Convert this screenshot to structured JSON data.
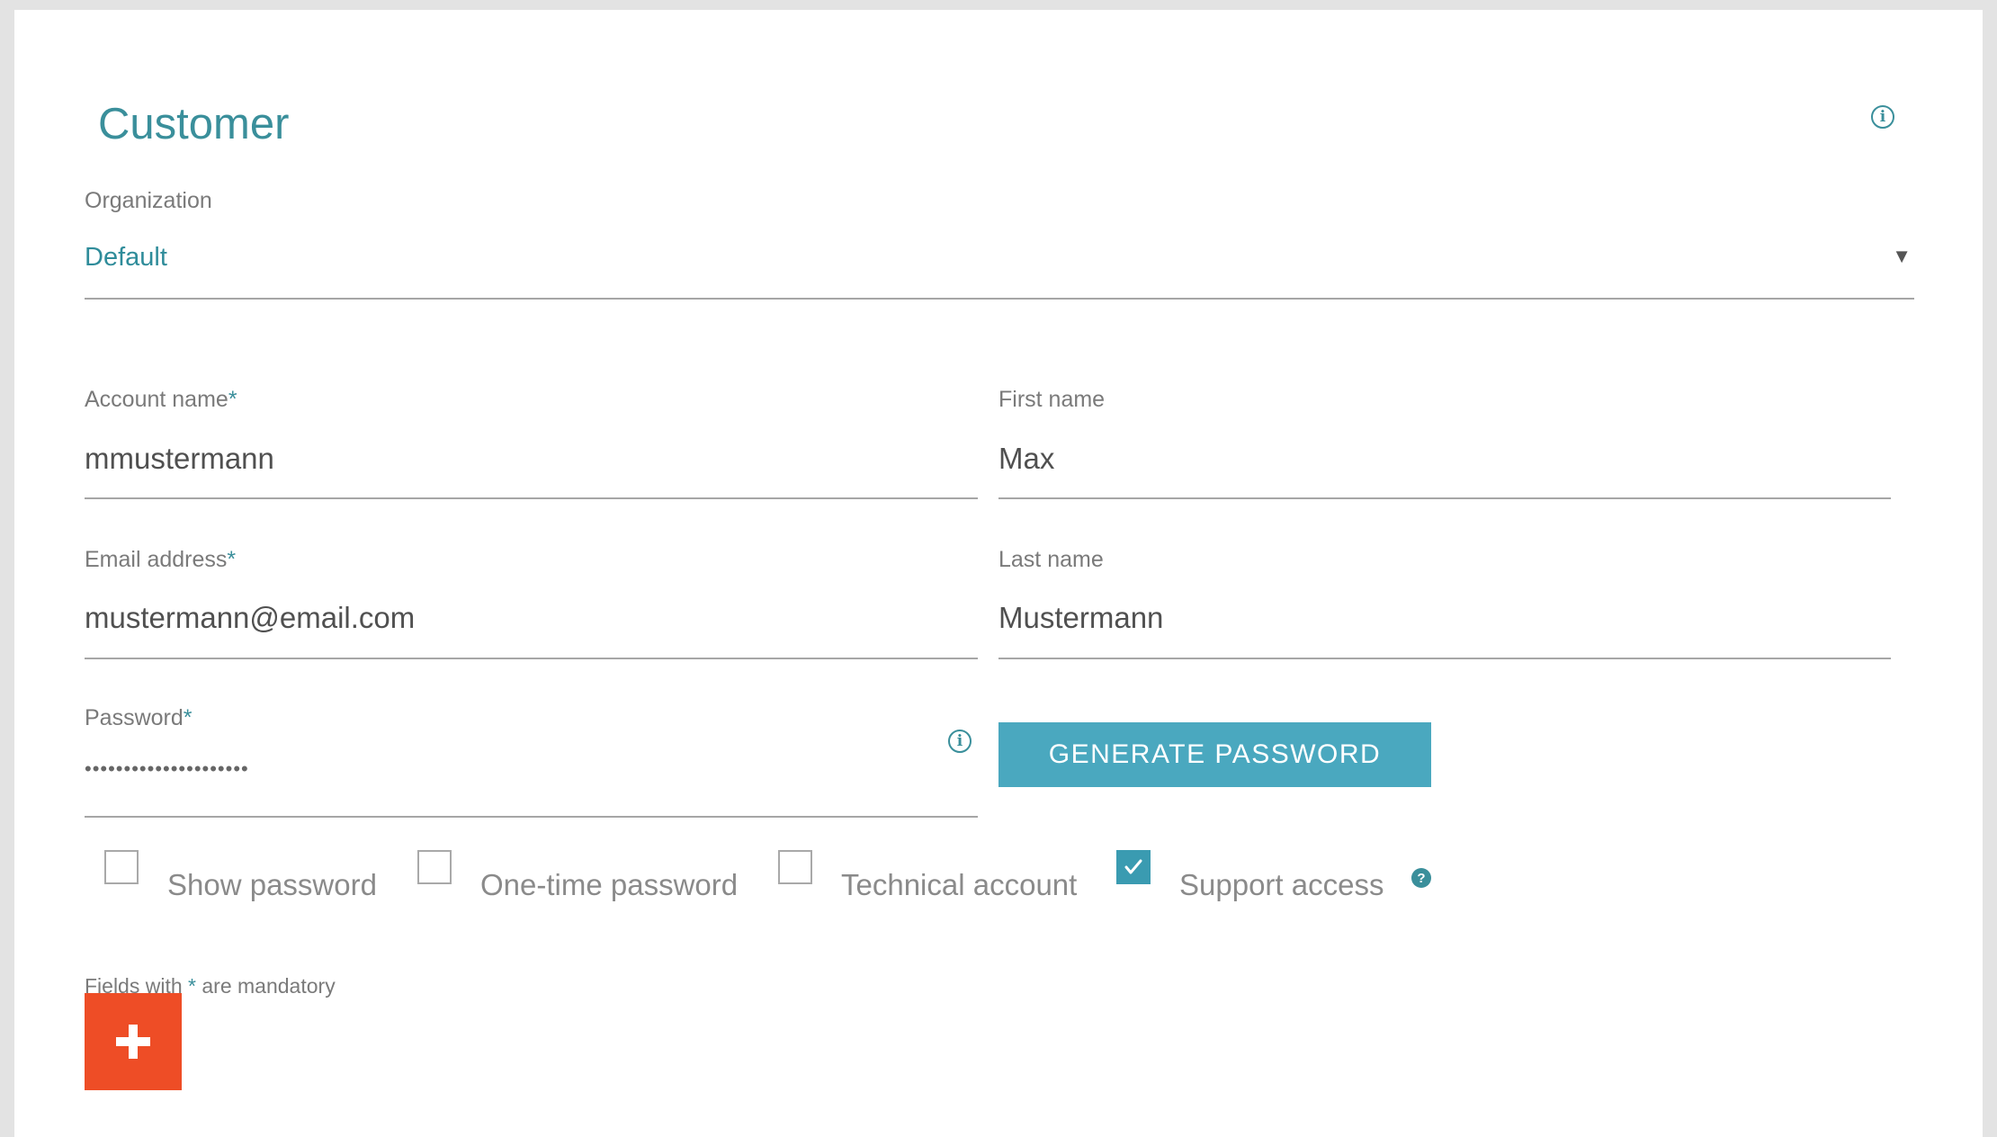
{
  "form": {
    "title": "Customer",
    "organization": {
      "label": "Organization",
      "value": "Default"
    },
    "account_name": {
      "label": "Account name",
      "required_mark": "*",
      "value": "mmustermann"
    },
    "first_name": {
      "label": "First name",
      "value": "Max"
    },
    "email": {
      "label": "Email address",
      "required_mark": "*",
      "value": "mustermann@email.com"
    },
    "last_name": {
      "label": "Last name",
      "value": "Mustermann"
    },
    "password": {
      "label": "Password",
      "required_mark": "*",
      "masked_value": "•••••••••••••••••••••"
    },
    "generate_button_label": "GENERATE PASSWORD",
    "checkboxes": [
      {
        "label": "Show password",
        "checked": false
      },
      {
        "label": "One-time password",
        "checked": false
      },
      {
        "label": "Technical account",
        "checked": false
      },
      {
        "label": "Support access",
        "checked": true
      }
    ],
    "mandatory_note": {
      "prefix": "Fields with ",
      "mark": "*",
      "suffix": " are mandatory"
    }
  },
  "icons": {
    "info": "info-icon",
    "dropdown": "chevron-down-icon",
    "help": "help-icon",
    "check": "check-icon",
    "add": "plus-icon"
  },
  "colors": {
    "accent": "#3a8f9b",
    "button": "#4aa8bf",
    "add_button": "#ee4d26",
    "checkbox_checked": "#3a9bb1"
  }
}
